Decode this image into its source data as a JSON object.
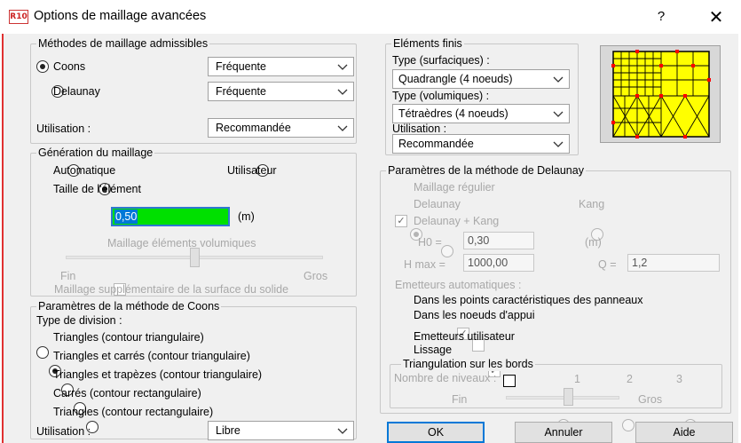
{
  "window": {
    "app_icon_text": "R10",
    "title": "Options de maillage avancées",
    "help_label": "?",
    "close_label": "✕"
  },
  "methods": {
    "legend": "Méthodes de maillage admissibles",
    "coons_label": "Coons",
    "coons_selected": true,
    "coons_freq": "Fréquente",
    "delaunay_label": "Delaunay",
    "delaunay_selected": false,
    "delaunay_freq": "Fréquente",
    "usage_label": "Utilisation :",
    "usage_value": "Recommandée"
  },
  "generation": {
    "legend": "Génération du maillage",
    "auto_label": "Automatique",
    "user_label": "Utilisateur",
    "size_label": "Taille de l'élément",
    "size_value": "0,50",
    "size_unit": "(m)",
    "volumic_label": "Maillage éléments volumiques",
    "fine_label": "Fin",
    "coarse_label": "Gros",
    "volumic_level": 0.5,
    "extra_label": "Maillage supplémentaire de la surface du solide"
  },
  "coons": {
    "legend": "Paramètres de la méthode de Coons",
    "division_label": "Type de division :",
    "options": [
      "Triangles (contour triangulaire)",
      "Triangles et carrés (contour triangulaire)",
      "Triangles et trapèzes (contour triangulaire)",
      "Carrés (contour rectangulaire)",
      "Triangles (contour rectangulaire)"
    ],
    "selected_index": 1,
    "usage_label": "Utilisation :",
    "usage_value": "Libre"
  },
  "finite": {
    "legend": "Eléments finis",
    "surf_label": "Type (surfaciques) :",
    "surf_value": "Quadrangle (4 noeuds)",
    "vol_label": "Type (volumiques) :",
    "vol_value": "Tétraèdres (4 noeuds)",
    "usage_label": "Utilisation :",
    "usage_value": "Recommandée",
    "preview_colors": {
      "fill": "#ffff00",
      "line": "#000000",
      "node": "#ff0000",
      "frame": "#a0a0a0"
    }
  },
  "delaunay": {
    "legend": "Paramètres de la méthode de Delaunay",
    "regular_label": "Maillage régulier",
    "delaunay_label": "Delaunay",
    "kang_label": "Kang",
    "dk_label": "Delaunay + Kang",
    "h0_label": "H0 =",
    "h0_value": "0,30",
    "h0_unit": "(m)",
    "hmax_label": "H max =",
    "hmax_value": "1000,00",
    "q_label": "Q =",
    "q_value": "1,2",
    "auto_emit_label": "Emetteurs automatiques :",
    "char_points_label": "Dans les points caractéristiques des panneaux",
    "support_nodes_label": "Dans les noeuds d'appui",
    "user_emit_label": "Emetteurs utilisateur",
    "smoothing_label": "Lissage",
    "edges": {
      "legend": "Triangulation sur les bords",
      "levels_label": "Nombre de niveaux :",
      "levels": [
        "1",
        "2",
        "3"
      ],
      "selected_level": "1",
      "fine_label": "Fin",
      "coarse_label": "Gros",
      "level": 0.55
    }
  },
  "buttons": {
    "ok": "OK",
    "cancel": "Annuler",
    "help": "Aide"
  }
}
